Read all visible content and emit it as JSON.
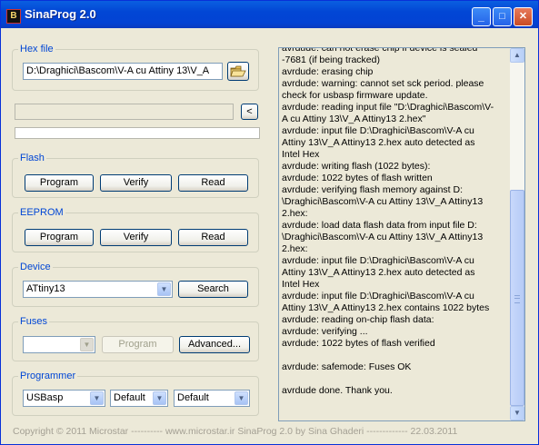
{
  "window": {
    "title": "SinaProg 2.0",
    "icon_text": "B",
    "controls": {
      "minimize": "_",
      "maximize": "□",
      "close": "✕"
    }
  },
  "hex_file": {
    "legend": "Hex file",
    "path": "D:\\Draghici\\Bascom\\V-A cu Attiny 13\\V_A",
    "open_icon": "folder-open-icon",
    "collapse_button": "<"
  },
  "flash": {
    "legend": "Flash",
    "program": "Program",
    "verify": "Verify",
    "read": "Read"
  },
  "eeprom": {
    "legend": "EEPROM",
    "program": "Program",
    "verify": "Verify",
    "read": "Read"
  },
  "device": {
    "legend": "Device",
    "selected": "ATtiny13",
    "search": "Search"
  },
  "fuses": {
    "legend": "Fuses",
    "selected": "",
    "program": "Program",
    "advanced": "Advanced..."
  },
  "programmer": {
    "legend": "Programmer",
    "selected": "USBasp",
    "port": "Default",
    "speed": "Default"
  },
  "log": {
    "lines": [
      "avrdude: can not erase chip if device is sealed",
      "-7681 (if being tracked)",
      "avrdude: erasing chip",
      "avrdude: warning: cannot set sck period. please",
      "check for usbasp firmware update.",
      "avrdude: reading input file \"D:\\Draghici\\Bascom\\V-",
      "A cu Attiny 13\\V_A Attiny13 2.hex\"",
      "avrdude: input file D:\\Draghici\\Bascom\\V-A cu",
      "Attiny 13\\V_A Attiny13 2.hex auto detected as",
      "Intel Hex",
      "avrdude: writing flash (1022 bytes):",
      "avrdude: 1022 bytes of flash written",
      "avrdude: verifying flash memory against D:",
      "\\Draghici\\Bascom\\V-A cu Attiny 13\\V_A Attiny13",
      "2.hex:",
      "avrdude: load data flash data from input file D:",
      "\\Draghici\\Bascom\\V-A cu Attiny 13\\V_A Attiny13",
      "2.hex:",
      "avrdude: input file D:\\Draghici\\Bascom\\V-A cu",
      "Attiny 13\\V_A Attiny13 2.hex auto detected as",
      "Intel Hex",
      "avrdude: input file D:\\Draghici\\Bascom\\V-A cu",
      "Attiny 13\\V_A Attiny13 2.hex contains 1022 bytes",
      "avrdude: reading on-chip flash data:",
      "avrdude: verifying ...",
      "avrdude: 1022 bytes of flash verified",
      "",
      "avrdude: safemode: Fuses OK",
      "",
      "avrdude done.  Thank you."
    ],
    "scroll_up": "▲",
    "scroll_down": "▼"
  },
  "statusbar": {
    "text": "Copyright © 2011 Microstar   ----------    www.microstar.ir       SinaProg 2.0  by  Sina Ghaderi    -------------    22.03.2011"
  }
}
